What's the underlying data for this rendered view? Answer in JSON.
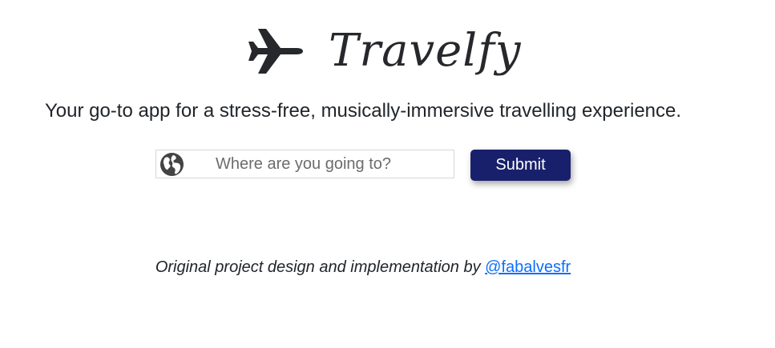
{
  "brand": {
    "name": "Travelfy",
    "icon": "airplane-icon"
  },
  "tagline": "Your go-to app for a stress-free, musically-immersive travelling experience.",
  "search": {
    "icon": "globe-icon",
    "placeholder": "Where are you going to?",
    "value": ""
  },
  "submit": {
    "label": "Submit"
  },
  "footer": {
    "text": "Original project design and implementation by ",
    "link_text": "@fabalvesfr"
  },
  "colors": {
    "button_bg": "#19206b",
    "link": "#0d6efd",
    "text": "#212529"
  }
}
